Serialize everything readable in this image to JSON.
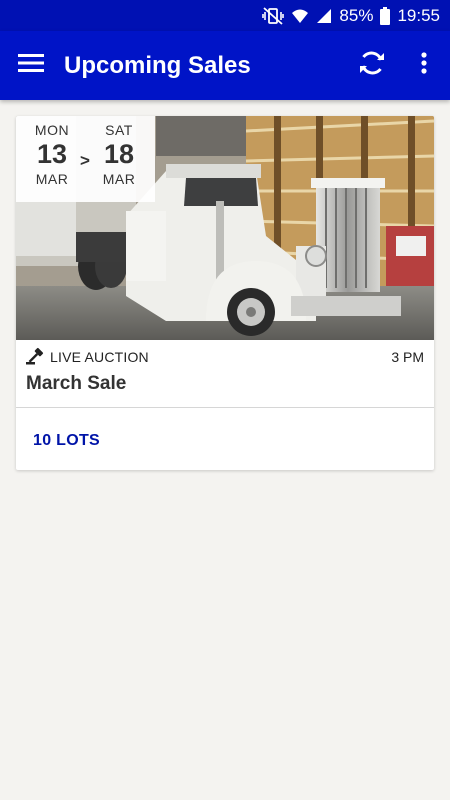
{
  "status_bar": {
    "battery_percent": "85%",
    "time": "19:55",
    "icons": [
      "vibrate-mute-icon",
      "wifi-icon",
      "signal-icon",
      "battery-icon"
    ]
  },
  "app_bar": {
    "title": "Upcoming Sales",
    "icons": [
      "menu-icon",
      "refresh-icon",
      "more-vert-icon"
    ]
  },
  "sales": [
    {
      "start_dow": "MON",
      "start_day": "13",
      "start_month": "MAR",
      "separator": ">",
      "end_dow": "SAT",
      "end_day": "18",
      "end_month": "MAR",
      "image_subject": "white semi truck cab in barn",
      "type_label": "LIVE AUCTION",
      "time": "3 PM",
      "name": "March Sale",
      "lots_label": "10 LOTS"
    }
  ],
  "colors": {
    "status_bar": "#0011b3",
    "app_bar": "#0014c7",
    "link": "#0014a8",
    "background": "#f4f3f0"
  }
}
